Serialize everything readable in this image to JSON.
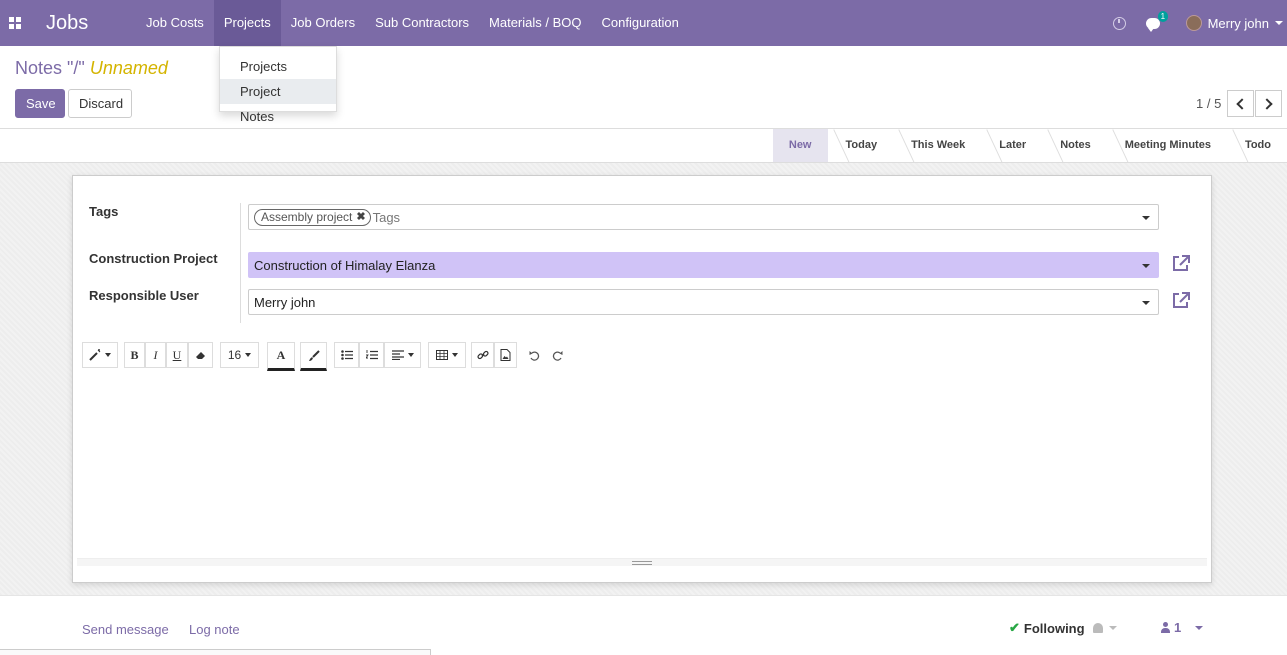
{
  "navbar": {
    "app_title": "Jobs",
    "menu": [
      {
        "label": "Job Costs"
      },
      {
        "label": "Projects"
      },
      {
        "label": "Job Orders"
      },
      {
        "label": "Sub Contractors"
      },
      {
        "label": "Materials / BOQ"
      },
      {
        "label": "Configuration"
      }
    ],
    "active_menu": "Projects",
    "chat_badge": "1",
    "user_name": "Merry john"
  },
  "dropdown": {
    "items": [
      {
        "label": "Projects"
      },
      {
        "label": "Project Notes"
      }
    ],
    "hovered": "Project Notes"
  },
  "breadcrumb": {
    "prefix": "Notes \"/\"",
    "record": "Unnamed"
  },
  "buttons": {
    "save": "Save",
    "discard": "Discard"
  },
  "pager": {
    "value": "1 / 5"
  },
  "statusbar": {
    "stages": [
      "New",
      "Today",
      "This Week",
      "Later",
      "Notes",
      "Meeting Minutes",
      "Todo"
    ],
    "active": "New"
  },
  "form": {
    "tags_label": "Tags",
    "tags": [
      "Assembly project"
    ],
    "tags_placeholder": "Tags",
    "project_label": "Construction Project",
    "project_value": "Construction of Himalay Elanza",
    "user_label": "Responsible User",
    "user_value": "Merry john"
  },
  "editor": {
    "font_size": "16"
  },
  "chatter": {
    "send_message": "Send message",
    "log_note": "Log note",
    "following": "Following",
    "followers_count": "1"
  },
  "colors": {
    "brand": "#7c6ba7",
    "highlight_field": "#d0c3f7",
    "unnamed": "#d4b400",
    "badge": "#00a09d"
  }
}
